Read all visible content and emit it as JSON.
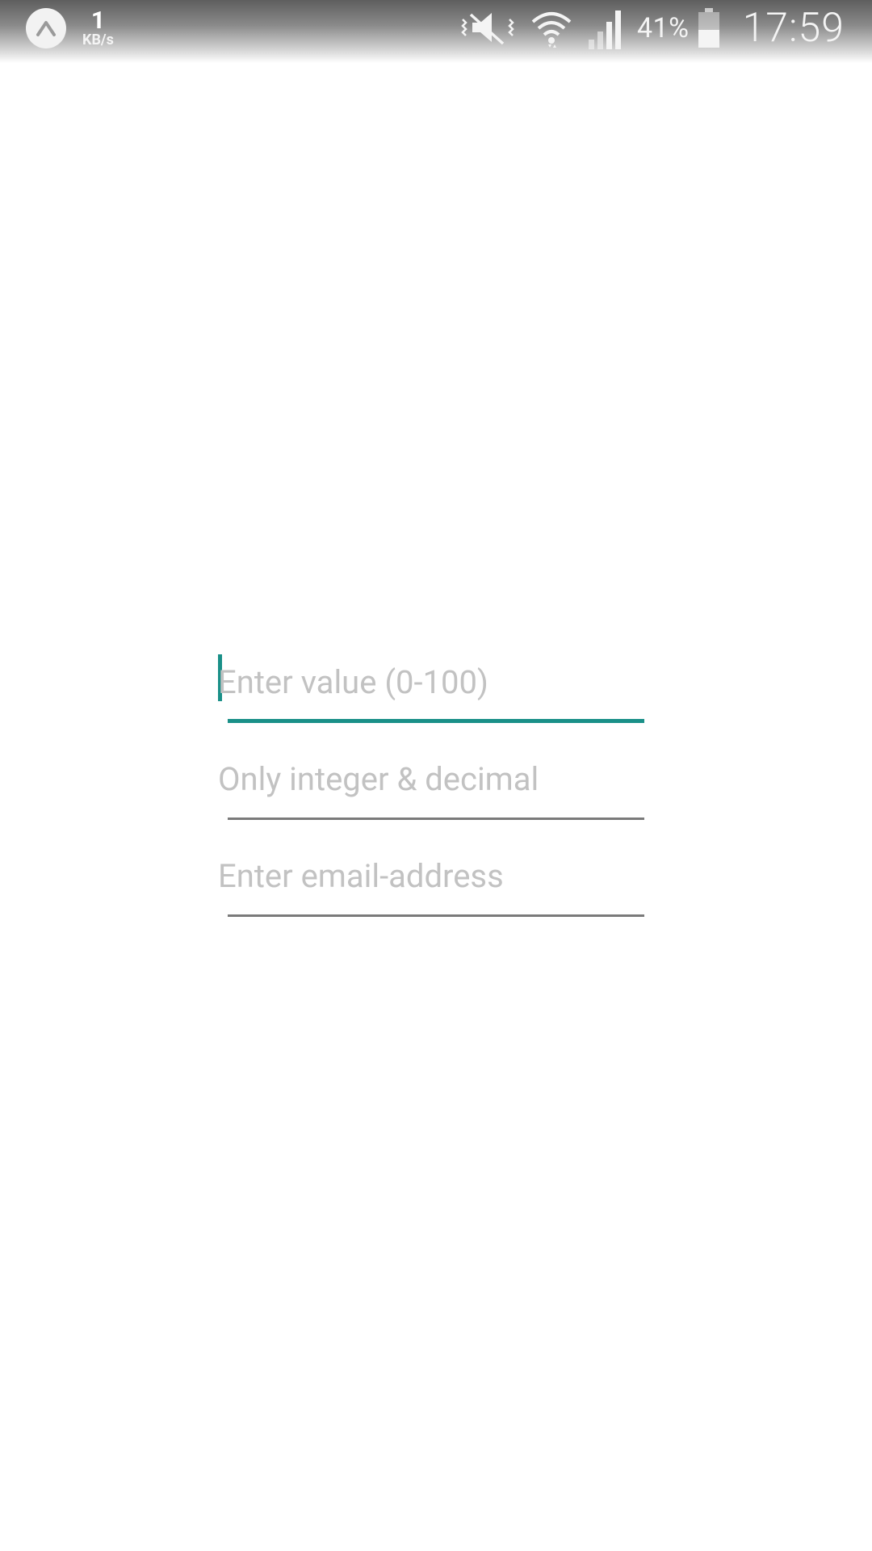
{
  "status_bar": {
    "net_speed_value": "1",
    "net_speed_unit": "KB/s",
    "battery_percent": "41%",
    "time": "17:59",
    "icons": [
      "app-badge-icon",
      "vibrate-icon",
      "wifi-icon",
      "signal-icon",
      "battery-icon"
    ]
  },
  "form": {
    "fields": [
      {
        "placeholder": "Enter value (0-100)",
        "value": "",
        "focused": true
      },
      {
        "placeholder": "Only integer & decimal",
        "value": "",
        "focused": false
      },
      {
        "placeholder": "Enter email-address",
        "value": "",
        "focused": false
      }
    ]
  },
  "colors": {
    "accent": "#1a9088",
    "underline": "#7a7a7a",
    "placeholder": "#c2c2c2"
  }
}
